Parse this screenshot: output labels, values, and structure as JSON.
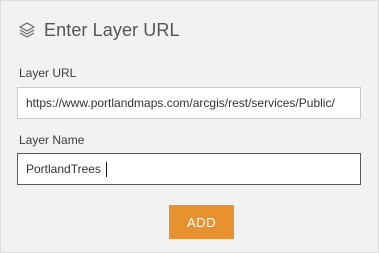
{
  "header": {
    "icon": "layers-icon",
    "title": "Enter Layer URL"
  },
  "fields": {
    "url": {
      "label": "Layer URL",
      "value": "https://www.portlandmaps.com/arcgis/rest/services/Public/"
    },
    "name": {
      "label": "Layer Name",
      "value": "PortlandTrees"
    }
  },
  "actions": {
    "add_label": "ADD",
    "add_color": "#e8922f"
  }
}
